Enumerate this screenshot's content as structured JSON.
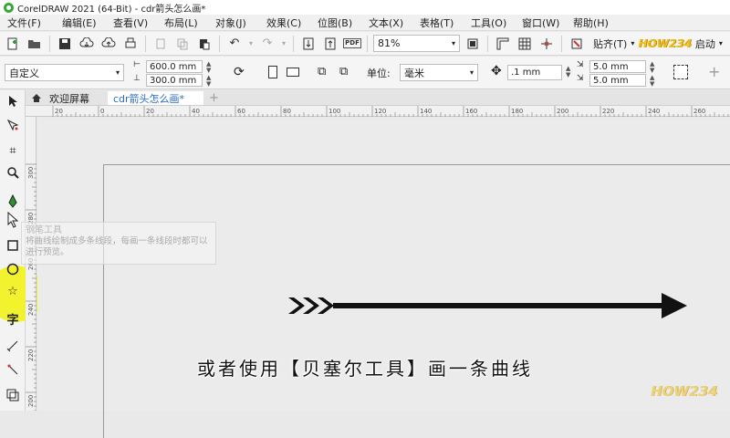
{
  "window": {
    "title": "CorelDRAW 2021 (64-Bit) - cdr箭头怎么画*"
  },
  "menu": [
    "文件(F)",
    "编辑(E)",
    "查看(V)",
    "布局(L)",
    "对象(J)",
    "效果(C)",
    "位图(B)",
    "文本(X)",
    "表格(T)",
    "工具(O)",
    "窗口(W)",
    "帮助(H)"
  ],
  "toolbar": {
    "zoom_value": "81%",
    "pdf_label": "PDF",
    "snap_label": "贴齐(T)",
    "launch_label": "启动",
    "brand_logo_text": "HOW234"
  },
  "property_bar": {
    "preset_value": "自定义",
    "width_value": "600.0 mm",
    "height_value": "300.0 mm",
    "units_label": "单位:",
    "units_value": "毫米",
    "nudge_value": ".1 mm",
    "dup_x_value": "5.0 mm",
    "dup_y_value": "5.0 mm"
  },
  "tabs": [
    {
      "label": "欢迎屏幕"
    },
    {
      "label": "cdr箭头怎么画*"
    }
  ],
  "ruler": {
    "h_ticks": [
      "20",
      "0",
      "20",
      "40",
      "60",
      "80",
      "100",
      "120",
      "140",
      "160",
      "180",
      "200",
      "220",
      "240",
      "260"
    ],
    "v_ticks": [
      "300",
      "280",
      "260",
      "240",
      "220",
      "200"
    ]
  },
  "toolbox": {
    "text_tool_glyph": "字"
  },
  "tooltip": {
    "title": "钢笔工具",
    "body": "将曲线绘制成多条线段，每画一条线段时都可以进行预览。"
  },
  "caption": "或者使用【贝塞尔工具】画一条曲线",
  "colors": {
    "highlight": "#f2f21a",
    "arrow": "#111111",
    "active_tab_text": "#2b6cc4"
  }
}
